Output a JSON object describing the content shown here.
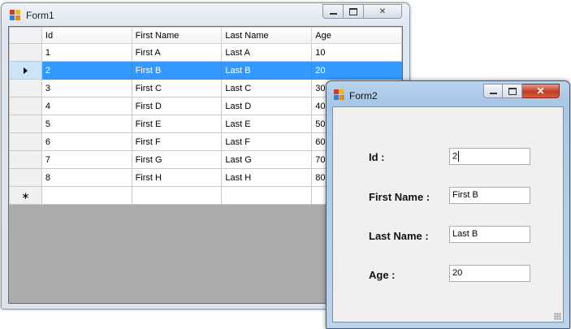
{
  "form1": {
    "title": "Form1",
    "grid": {
      "columns": [
        "Id",
        "First Name",
        "Last Name",
        "Age"
      ],
      "rows": [
        {
          "id": "1",
          "first": "First A",
          "last": "Last A",
          "age": "10"
        },
        {
          "id": "2",
          "first": "First B",
          "last": "Last B",
          "age": "20"
        },
        {
          "id": "3",
          "first": "First C",
          "last": "Last C",
          "age": "30"
        },
        {
          "id": "4",
          "first": "First D",
          "last": "Last D",
          "age": "40"
        },
        {
          "id": "5",
          "first": "First E",
          "last": "Last E",
          "age": "50"
        },
        {
          "id": "6",
          "first": "First F",
          "last": "Last F",
          "age": "60"
        },
        {
          "id": "7",
          "first": "First G",
          "last": "Last G",
          "age": "70"
        },
        {
          "id": "8",
          "first": "First H",
          "last": "Last H",
          "age": "80"
        }
      ],
      "selected_row": 1,
      "new_row_marker": "∗"
    }
  },
  "form2": {
    "title": "Form2",
    "close_glyph": "✕",
    "fields": {
      "id_label": "Id :",
      "id_value": "2",
      "first_name_label": "First Name :",
      "first_name_value": "First B",
      "last_name_label": "Last Name :",
      "last_name_value": "Last B",
      "age_label": "Age :",
      "age_value": "20"
    }
  },
  "icons": {
    "app_icon": "app-icon",
    "minimize": "minimize-icon",
    "maximize": "maximize-icon",
    "close": "close-icon",
    "row_selector": "arrow-right-icon",
    "resize_grip": "resize-grip-icon"
  },
  "colors": {
    "selection": "#3399ff",
    "grid_background": "#ababab",
    "active_title": "#a9c8e8",
    "inactive_title": "#dfe6ef",
    "close_button": "#c43a24"
  }
}
